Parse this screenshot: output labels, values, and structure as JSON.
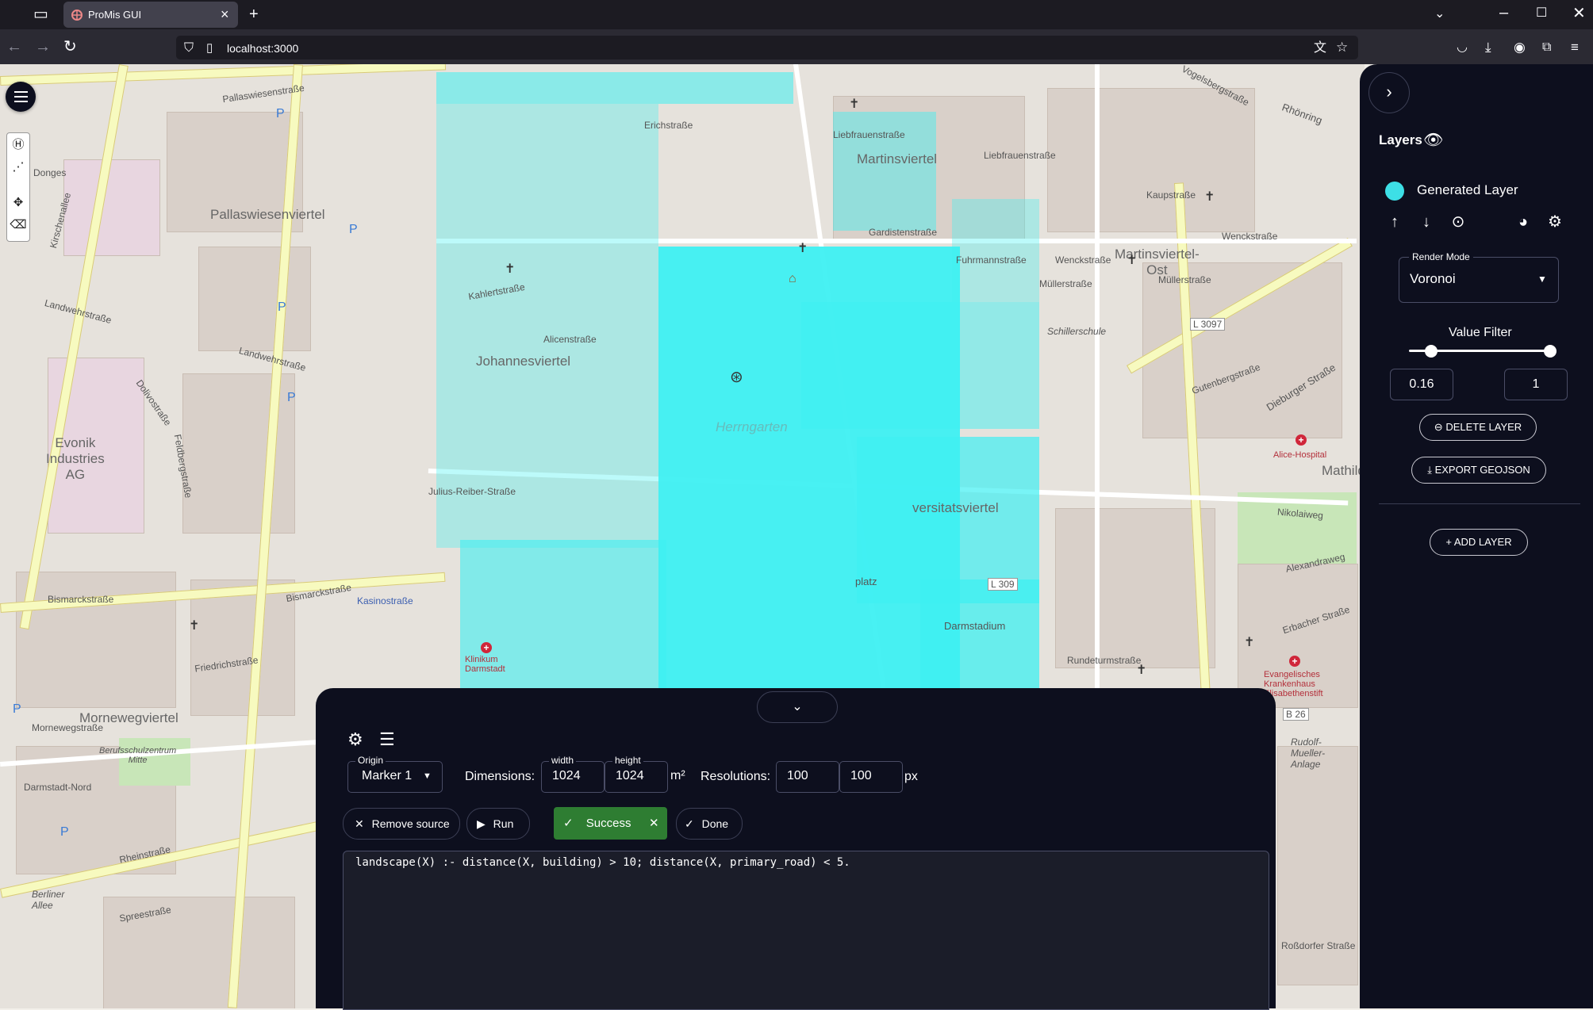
{
  "browser": {
    "tab_title": "ProMis GUI",
    "url": "localhost:3000"
  },
  "map": {
    "labels": {
      "pallaswiesenstrasse_top": "Pallaswiesenstraße",
      "pallaswiesenviertel": "Pallaswiesenviertel",
      "donges": "Donges",
      "kirschenallee": "Kirschenallee",
      "landwehrstrasse": "Landwehrstraße",
      "dolivostrasse": "Dolivostraße",
      "feldbergstrasse": "Feldbergstraße",
      "evonik": "Evonik\nIndustries\nAG",
      "johannesviertel": "Johannesviertel",
      "julius_reiber": "Julius-Reiber-Straße",
      "bismarckstrasse": "Bismarckstraße",
      "kasinostrasse": "Kasinostraße",
      "mornewegviertel": "Mornewegviertel",
      "morneweg_strasse": "Mornewegstraße",
      "rheinstrasse": "Rheinstraße",
      "berliner_allee": "Berliner\nAllee",
      "spreestrasse": "Spreestraße",
      "martinsviertel": "Martinsviertel",
      "martinsviertel_ost": "Martinsviertel-\nOst",
      "kaupstrasse": "Kaupstraße",
      "liebfrauenstrasse": "Liebfrauenstraße",
      "vogelsbergstrasse": "Vogelsbergstraße",
      "rhoenring": "Rhönring",
      "gardistenstrasse": "Gardistenstraße",
      "fuhrmannstrasse": "Fuhrmannstraße",
      "wenckstrasse": "Wenckstraße",
      "muellerstrasse": "Müllerstraße",
      "schillerschule": "Schillerschule",
      "l3097": "L 3097",
      "gutenbergstrasse": "Gutenbergstraße",
      "dieburger_strasse": "Dieburger Straße",
      "alice_hospital": "Alice-Hospital",
      "mathilde": "Mathilde",
      "nikolaiweg": "Nikolaiweg",
      "alexandraweg": "Alexandraweg",
      "universitatsviertel": "versitatsviertel",
      "darmstadium": "Darmstadium",
      "l309": "L 309",
      "klinikum": "Klinikum\nDarmstadt",
      "evangelisches": "Evangelisches\nKrankenhaus\nElisabethenstift",
      "b26": "B 26",
      "rudolf_mueller": "Rudolf-\nMueller-\nAnlage",
      "rundeturmstrasse": "Rundeturmstraße",
      "erbacher": "Erbacher Straße",
      "rossdorfer": "Roßdorfer Straße",
      "herrngarten": "Herrngarten",
      "platz": "platz",
      "berufsschulzentrum": "Berufsschulzentrum\nMitte",
      "darmstadt_nord": "Darmstadt-Nord",
      "friedrichstrasse": "Friedrichstraße",
      "erichstrasse": "Erichstraße",
      "alicenstrasse": "Alicenstraße",
      "kahlertstrasse": "Kahlertstraße"
    }
  },
  "layers_panel": {
    "title": "Layers",
    "layer_name": "Generated Layer",
    "layer_color": "#3ddfe6",
    "render_mode_label": "Render Mode",
    "render_mode_value": "Voronoi",
    "value_filter_label": "Value Filter",
    "filter_min": 0.16,
    "filter_max": 1,
    "filter_min_text": "0.16",
    "filter_max_text": "1",
    "delete_label": "DELETE LAYER",
    "export_label": "EXPORT GEOJSON",
    "add_label": "ADD LAYER"
  },
  "bottom_panel": {
    "origin_label": "Origin",
    "origin_value": "Marker 1",
    "dimensions_label": "Dimensions:",
    "width_label": "width",
    "width_value": "1024",
    "height_label": "height",
    "height_value": "1024",
    "dim_unit": "m²",
    "resolutions_label": "Resolutions:",
    "res_x": "100",
    "res_y": "100",
    "res_unit": "px",
    "remove_source": "Remove source",
    "run": "Run",
    "success": "Success",
    "done": "Done",
    "code": "landscape(X) :- distance(X, building) > 10; distance(X, primary_road) < 5."
  },
  "colors": {
    "panel_bg": "#0d0f1e",
    "overlay_cyan": "#3ef0f2",
    "success_green": "#2e7d32"
  }
}
